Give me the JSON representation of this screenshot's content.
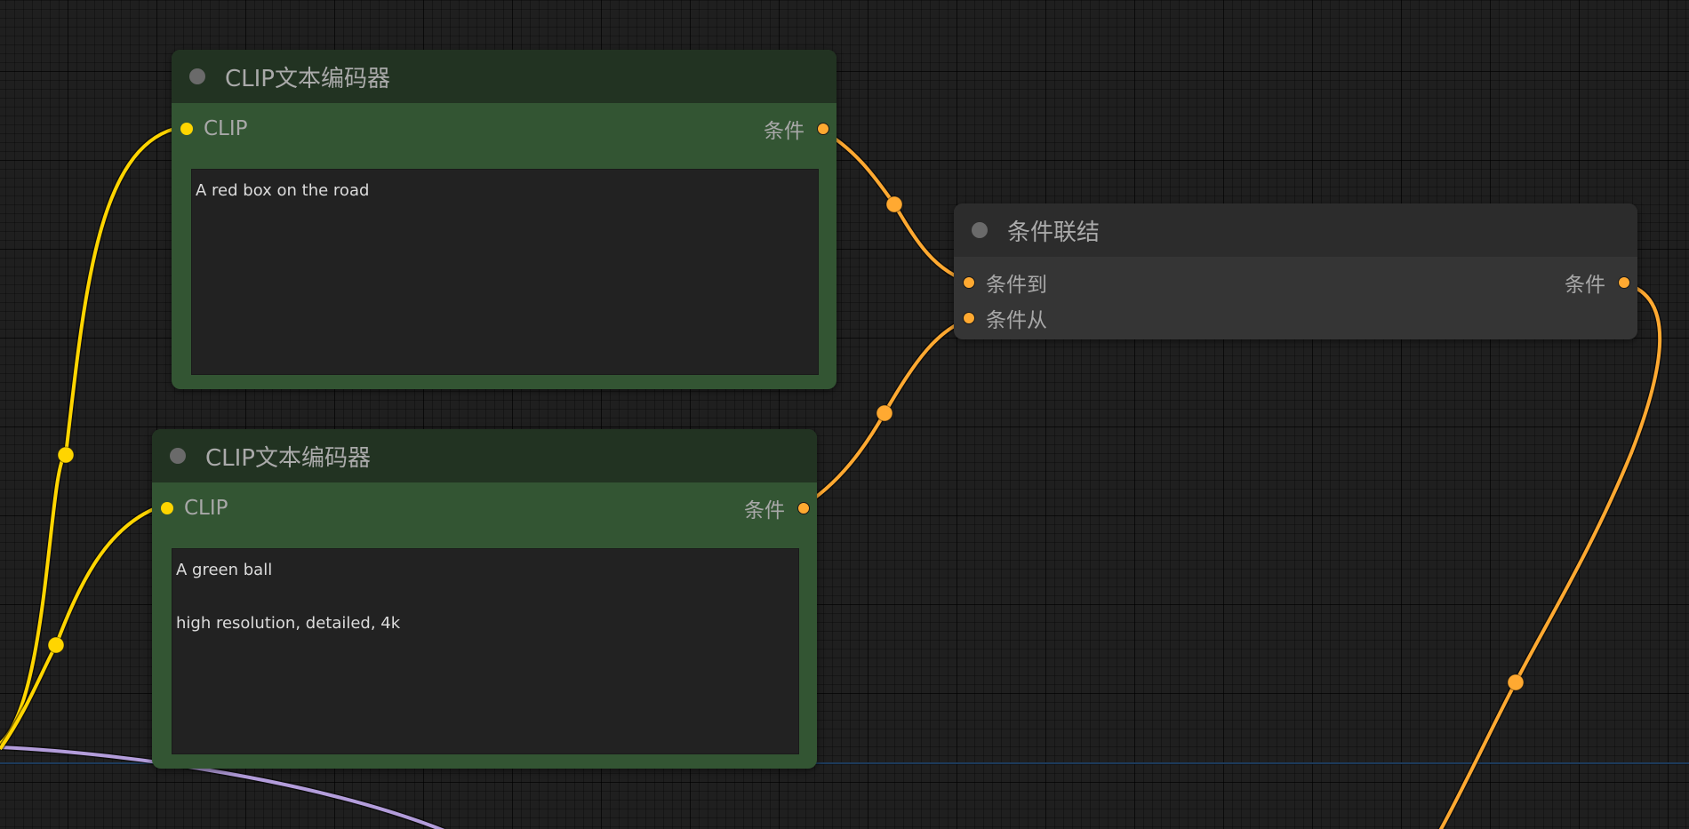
{
  "nodes": {
    "clip_encoder_1": {
      "title": "CLIP文本编码器",
      "input_label": "CLIP",
      "output_label": "条件",
      "text": "A red box on the road"
    },
    "clip_encoder_2": {
      "title": "CLIP文本编码器",
      "input_label": "CLIP",
      "output_label": "条件",
      "text": "A green ball\n\nhigh resolution, detailed, 4k"
    },
    "conditioning_concat": {
      "title": "条件联结",
      "input_to_label": "条件到",
      "input_from_label": "条件从",
      "output_label": "条件"
    }
  },
  "colors": {
    "canvas_bg": "#1f1f1f",
    "clip_link": "#ffd500",
    "conditioning_link": "#ffa931",
    "model_link": "#b39ddb",
    "green_node_body": "#335533",
    "green_node_header": "#223322",
    "gray_node_body": "#353535"
  },
  "icons": {
    "collapse": "collapse-dot-icon",
    "input_port": "input-port-icon",
    "output_port": "output-port-icon",
    "link_midpoint": "link-midpoint-icon"
  }
}
